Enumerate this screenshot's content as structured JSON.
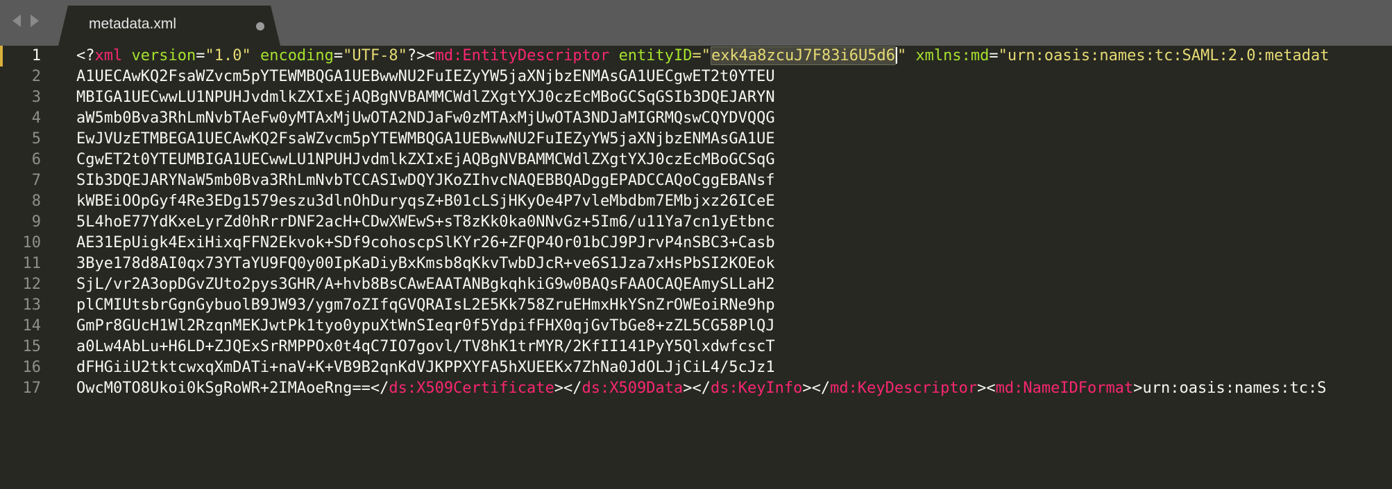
{
  "tabbar": {
    "tab": {
      "label": "metadata.xml"
    }
  },
  "editor": {
    "current_line": 1,
    "line_numbers": [
      "1",
      "2",
      "3",
      "4",
      "5",
      "6",
      "7",
      "8",
      "9",
      "10",
      "11",
      "12",
      "13",
      "14",
      "15",
      "16",
      "17"
    ],
    "line1": {
      "open": "<?",
      "xml_name": "xml",
      "attr_version": "version",
      "eq1": "=",
      "val_version": "\"1.0\"",
      "attr_encoding": "encoding",
      "eq2": "=",
      "val_encoding": "\"UTF-8\"",
      "close_decl": "?><",
      "entity_tag": "md:EntityDescriptor",
      "attr_entityid": "entityID",
      "eq3": "=\"",
      "entityid_value": "exk4a8zcuJ7F83i6U5d6",
      "quote_close": "\"",
      "attr_xmlns": "xmlns:md",
      "eq4": "=",
      "xmlns_value": "\"urn:oasis:names:tc:SAML:2.0:metadat"
    },
    "cert_lines": [
      "A1UECAwKQ2FsaWZvcm5pYTEWMBQGA1UEBwwNU2FuIEZyYW5jaXNjbzENMAsGA1UECgwET2t0YTEU",
      "MBIGA1UECwwLU1NPUHJvdmlkZXIxEjAQBgNVBAMMCWdlZXgtYXJ0czEcMBoGCSqGSIb3DQEJARYN",
      "aW5mb0Bva3RhLmNvbTAeFw0yMTAxMjUwOTA2NDJaFw0zMTAxMjUwOTA3NDJaMIGRMQswCQYDVQQG",
      "EwJVUzETMBEGA1UECAwKQ2FsaWZvcm5pYTEWMBQGA1UEBwwNU2FuIEZyYW5jaXNjbzENMAsGA1UE",
      "CgwET2t0YTEUMBIGA1UECwwLU1NPUHJvdmlkZXIxEjAQBgNVBAMMCWdlZXgtYXJ0czEcMBoGCSqG",
      "SIb3DQEJARYNaW5mb0Bva3RhLmNvbTCCASIwDQYJKoZIhvcNAQEBBQADggEPADCCAQoCggEBANsf",
      "kWBEiOOpGyf4Re3EDg1579eszu3dlnOhDuryqsZ+B01cLSjHKyOe4P7vleMbdbm7EMbjxz26ICeE",
      "5L4hoE77YdKxeLyrZd0hRrrDNF2acH+CDwXWEwS+sT8zKk0ka0NNvGz+5Im6/u11Ya7cn1yEtbnc",
      "AE31EpUigk4ExiHixqFFN2Ekvok+SDf9cohoscpSlKYr26+ZFQP4Or01bCJ9PJrvP4nSBC3+Casb",
      "3Bye178d8AI0qx73YTaYU9FQ0y00IpKaDiyBxKmsb8qKkvTwbDJcR+ve6S1Jza7xHsPbSI2KOEok",
      "SjL/vr2A3opDGvZUto2pys3GHR/A+hvb8BsCAwEAATANBgkqhkiG9w0BAQsFAAOCAQEAmySLLaH2",
      "plCMIUtsbrGgnGybuolB9JW93/ygm7oZIfqGVQRAIsL2E5Kk758ZruEHmxHkYSnZrOWEoiRNe9hp",
      "GmPr8GUcH1Wl2RzqnMEKJwtPk1tyo0ypuXtWnSIeqr0f5YdpifFHX0qjGvTbGe8+zZL5CG58PlQJ",
      "a0Lw4AbLu+H6LD+ZJQExSrRMPPOx0t4qC7IO7govl/TV8hK1trMYR/2KfII141PyY5QlxdwfcscT",
      "dFHGiiU2tktcwxqXmDATi+naV+K+VB9B2qnKdVJKPPXYFA5hXUEEKx7ZhNa0JdOLJjCiL4/5cJz1"
    ],
    "line17": {
      "text_start": "OwcM0TO8Ukoi0kSgRoWR+2IMAoeRng==</",
      "tag_cert": "ds:X509Certificate",
      "sep1": "></",
      "tag_x509data": "ds:X509Data",
      "sep2": "></",
      "tag_keyinfo": "ds:KeyInfo",
      "sep3": "></",
      "tag_keydesc": "md:KeyDescriptor",
      "sep4": "><",
      "tag_nameid": "md:NameIDFormat",
      "text_end": ">urn:oasis:names:tc:S"
    }
  },
  "colors": {
    "background": "#272822",
    "tabbar": "#5a5a5a",
    "tag": "#f92672",
    "attribute": "#a6e22e",
    "string": "#e6db74",
    "text": "#f8f8f2",
    "line_number": "#8f908a",
    "current_line_marker": "#d8b13d"
  },
  "icons": [
    "chevron-left-icon",
    "chevron-right-icon",
    "unsaved-dot-icon"
  ]
}
